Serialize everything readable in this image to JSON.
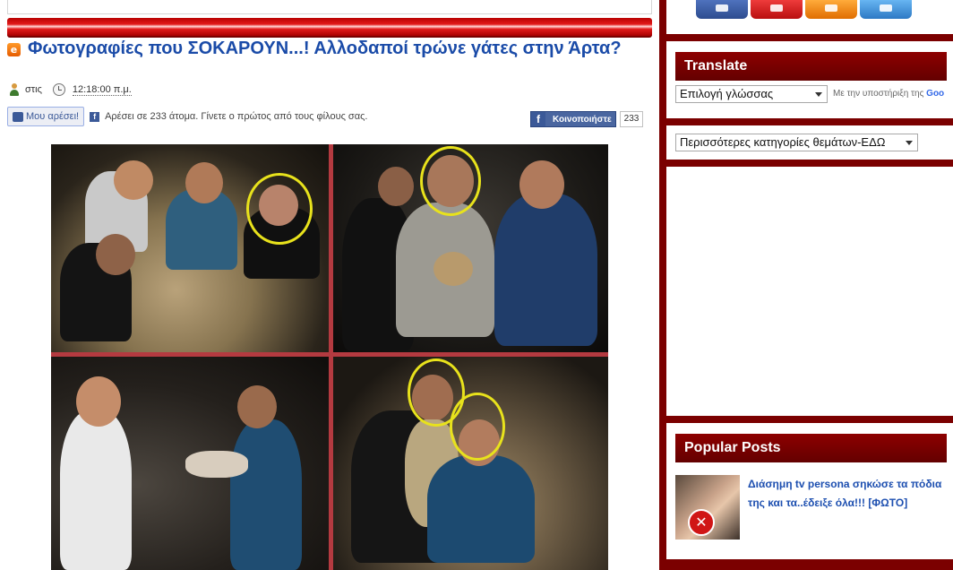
{
  "post": {
    "title": "Φωτογραφίες που ΣΟΚΑΡΟΥΝ...! Αλλοδαποί τρώνε γάτες στην Άρτα?",
    "author_prefix": "στις",
    "time": "12:18:00 π.μ."
  },
  "facebook": {
    "like_label": "Μου αρέσει!",
    "like_text": "Αρέσει σε 233 άτομα. Γίνετε ο πρώτος από τους φίλους σας.",
    "share_label": "Κοινοποιήστε",
    "share_count": "233"
  },
  "sidebar": {
    "social_icons": [
      {
        "name": "facebook-icon",
        "color": "#3b5998"
      },
      {
        "name": "youtube-icon",
        "color": "#d42323"
      },
      {
        "name": "rss-icon",
        "color": "#f08a1e"
      },
      {
        "name": "twitter-icon",
        "color": "#3b8fd8"
      }
    ],
    "translate": {
      "title": "Translate",
      "select_value": "Επιλογή γλώσσας",
      "powered_by": "Με την υποστήριξη της",
      "google": "Goo"
    },
    "categories_select": "Περισσότερες κατηγορίες θεμάτων-ΕΔΩ",
    "popular": {
      "title": "Popular Posts",
      "items": [
        {
          "title": "Διάσημη tv persona σηκώσε τα πόδια της και τα..έδειξε όλα!!! [ΦΩΤΟ]"
        }
      ]
    }
  },
  "colors": {
    "brand_red": "#7b0000",
    "title_blue": "#1a4ba8",
    "circle_yellow": "#e8e21c"
  }
}
